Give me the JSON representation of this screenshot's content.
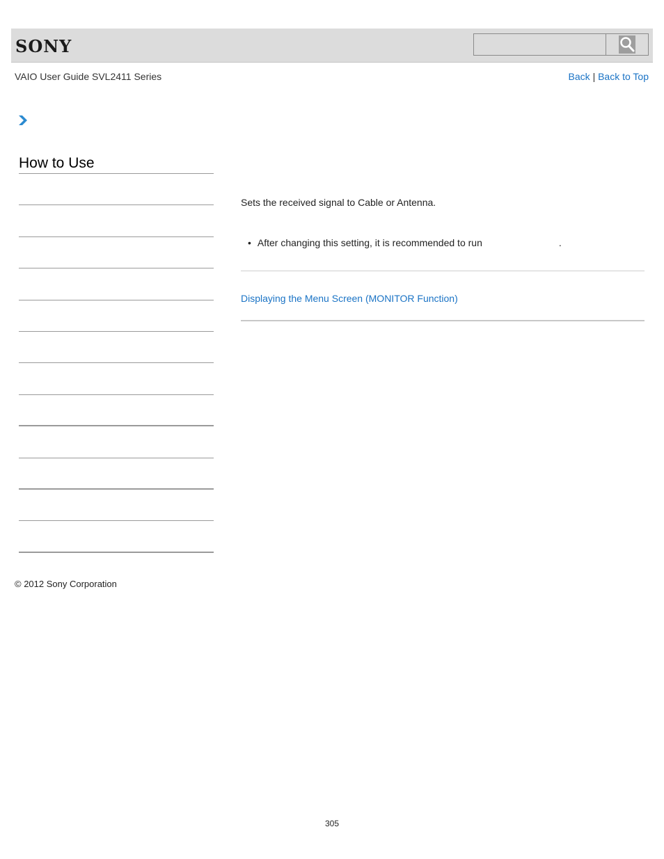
{
  "header": {
    "logo": "SONY",
    "search": {
      "value": "",
      "placeholder": ""
    },
    "search_icon": "search-icon"
  },
  "nav": {
    "guide_title": "VAIO User Guide SVL2411 Series",
    "back_label": "Back",
    "separator": "|",
    "back_to_top_label": "Back to Top"
  },
  "breadcrumb": {
    "icon": "chevron-right-icon"
  },
  "sidebar": {
    "title": "How to Use",
    "items": [
      {
        "label": ""
      },
      {
        "label": ""
      },
      {
        "label": ""
      },
      {
        "label": ""
      },
      {
        "label": ""
      },
      {
        "label": ""
      },
      {
        "label": ""
      },
      {
        "label": ""
      },
      {
        "label": ""
      },
      {
        "label": ""
      },
      {
        "label": ""
      },
      {
        "label": ""
      }
    ]
  },
  "content": {
    "description": "Sets the received signal to Cable or Antenna.",
    "note": {
      "bullet": "•",
      "text_before": "After changing this setting, it is recommended to run",
      "text_after": "."
    },
    "related_link": "Displaying the Menu Screen (MONITOR Function)"
  },
  "footer": {
    "copyright": "© 2012 Sony Corporation",
    "page_number": "305"
  },
  "colors": {
    "link": "#1a73c5",
    "header_bg": "#dcdcdc"
  }
}
